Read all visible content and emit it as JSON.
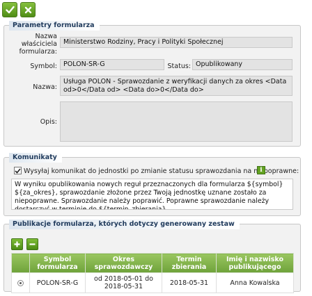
{
  "toolbar": {
    "accept_icon": "checkmark-icon",
    "cancel_icon": "close-icon"
  },
  "params": {
    "title": "Parametry formularza",
    "owner_label": "Nazwa właściciela formularza:",
    "owner_value": "Ministerstwo Rodziny, Pracy i Polityki Społecznej",
    "symbol_label": "Symbol:",
    "symbol_value": "POLON-SR-G",
    "status_label": "Status:",
    "status_value": "Opublikowany",
    "name_label": "Nazwa:",
    "name_value": "Usługa POLON - Sprawozdanie z weryfikacji danych za okres <Data od>0</Data od> <Data do>0</Data do>",
    "desc_label": "Opis:",
    "desc_value": ""
  },
  "messages": {
    "title": "Komunikaty",
    "send_checked": true,
    "send_label": "Wysyłaj komunikat do jednostki po zmianie statusu sprawozdania na niepoprawne:",
    "info_icon": "info-icon",
    "message_text": "W wyniku opublikowania nowych reguł przeznaczonych dla formularza ${symbol} ${za_okres}, sprawozdanie złożone przez Twoją jednostkę uznane zostało za niepoprawne. Sprawozdanie należy poprawić. Poprawne sprawozdanie należy dostarczyć w terminie do ${termin_zbierania}."
  },
  "publications": {
    "title": "Publikacje formularza, których dotyczy generowany zestaw",
    "columns": [
      "",
      "Symbol formularza",
      "Okres sprawozdawczy",
      "Termin zbierania",
      "Imię i nazwisko publikującego"
    ],
    "rows": [
      {
        "symbol": "POLON-SR-G",
        "period": "od 2018-05-01 do 2018-05-31",
        "deadline": "2018-05-31",
        "publisher": "Anna Kowalska"
      }
    ]
  }
}
